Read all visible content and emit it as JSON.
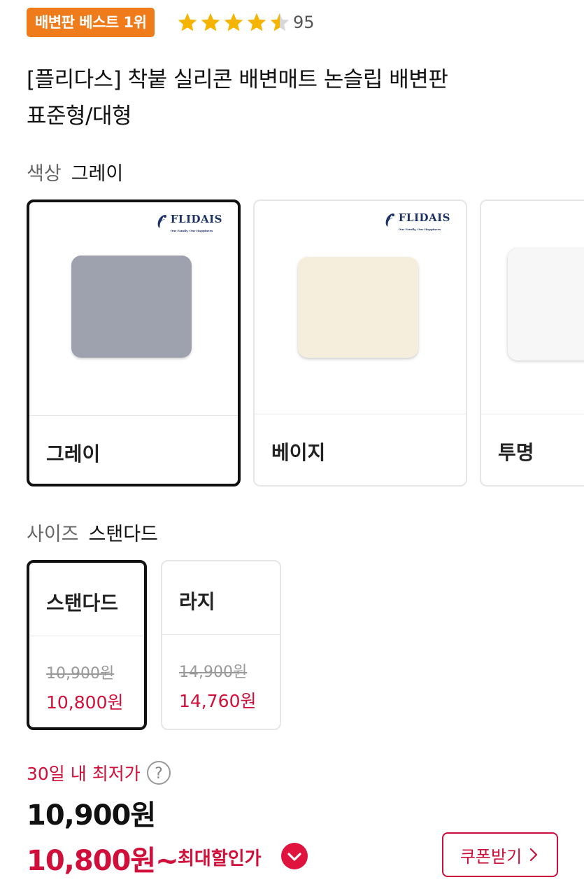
{
  "badge": {
    "text": "배변판 베스트 1위",
    "color": "#f07b1b"
  },
  "rating": {
    "value": 4.5,
    "max": 5,
    "count": "95",
    "star_color": "#f5b400"
  },
  "product": {
    "title_line1": "[플리다스] 착붙 실리콘 배변매트 논슬립 배변판",
    "title_line2": "표준형/대형"
  },
  "color_option": {
    "label": "색상",
    "selected_value": "그레이",
    "brand": "FLIDAIS",
    "brand_tagline": "Our Family, Our Happiness",
    "items": [
      {
        "name": "그레이",
        "selected": true,
        "swatch": "#9b9fad"
      },
      {
        "name": "베이지",
        "selected": false,
        "swatch": "#f3ecdb"
      },
      {
        "name": "투명",
        "selected": false,
        "swatch": "#f6f6f6"
      }
    ]
  },
  "size_option": {
    "label": "사이즈",
    "selected_value": "스탠다드",
    "items": [
      {
        "name": "스탠다드",
        "original_price": "10,900원",
        "sale_price": "10,800원",
        "selected": true
      },
      {
        "name": "라지",
        "original_price": "14,900원",
        "sale_price": "14,760원",
        "selected": false
      }
    ]
  },
  "pricing": {
    "lowest_label": "30일 내 최저가",
    "price": "10,900원",
    "sale_price": "10,800원~",
    "max_discount_label": "최대할인가",
    "coupon_button": "쿠폰받기",
    "accent_color": "#d0103a"
  }
}
